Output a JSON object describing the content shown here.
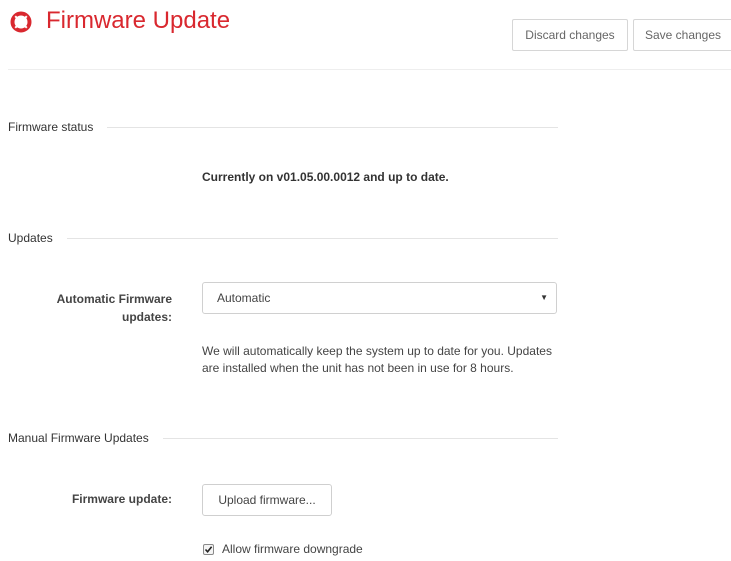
{
  "header": {
    "title": "Firmware Update",
    "icon": "lifebuoy-icon",
    "discard_label": "Discard changes",
    "save_label": "Save changes",
    "accent_color": "#d9282f"
  },
  "firmware_status": {
    "section_title": "Firmware status",
    "status_text": "Currently on v01.05.00.0012 and up to date."
  },
  "updates": {
    "section_title": "Updates",
    "auto_label": "Automatic Firmware updates:",
    "auto_selected": "Automatic",
    "help_text": "We will automatically keep the system up to date for you. Updates are installed when the unit has not been in use for 8 hours."
  },
  "manual": {
    "section_title": "Manual Firmware Updates",
    "firmware_label": "Firmware update:",
    "upload_label": "Upload firmware...",
    "downgrade_label": "Allow firmware downgrade",
    "downgrade_checked": true
  }
}
